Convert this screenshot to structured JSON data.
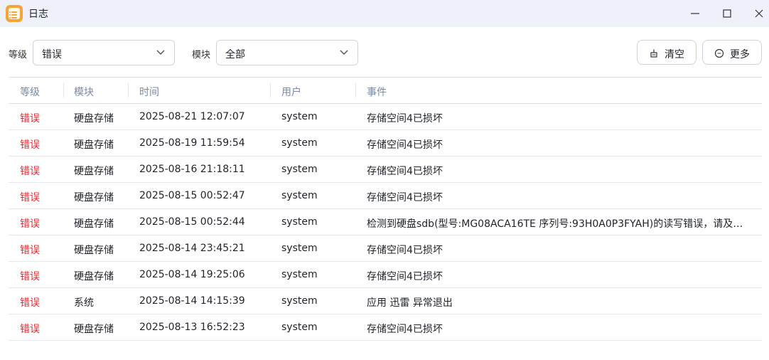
{
  "window": {
    "title": "日志"
  },
  "filters": {
    "level_label": "等级",
    "level_value": "错误",
    "module_label": "模块",
    "module_value": "全部"
  },
  "actions": {
    "clear_label": "清空",
    "more_label": "更多"
  },
  "table": {
    "columns": [
      "等级",
      "模块",
      "时间",
      "用户",
      "事件"
    ],
    "rows": [
      {
        "level": "错误",
        "module": "硬盘存储",
        "time": "2025-08-21 12:07:07",
        "user": "system",
        "event": "存储空间4已损坏"
      },
      {
        "level": "错误",
        "module": "硬盘存储",
        "time": "2025-08-19 11:59:54",
        "user": "system",
        "event": "存储空间4已损坏"
      },
      {
        "level": "错误",
        "module": "硬盘存储",
        "time": "2025-08-16 21:18:11",
        "user": "system",
        "event": "存储空间4已损坏"
      },
      {
        "level": "错误",
        "module": "硬盘存储",
        "time": "2025-08-15 00:52:47",
        "user": "system",
        "event": "存储空间4已损坏"
      },
      {
        "level": "错误",
        "module": "硬盘存储",
        "time": "2025-08-15 00:52:44",
        "user": "system",
        "event": "检测到硬盘sdb(型号:MG08ACA16TE 序列号:93H0A0P3FYAH)的读写错误，请及时..."
      },
      {
        "level": "错误",
        "module": "硬盘存储",
        "time": "2025-08-14 23:45:21",
        "user": "system",
        "event": "存储空间4已损坏"
      },
      {
        "level": "错误",
        "module": "硬盘存储",
        "time": "2025-08-14 19:25:06",
        "user": "system",
        "event": "存储空间4已损坏"
      },
      {
        "level": "错误",
        "module": "系统",
        "time": "2025-08-14 14:15:39",
        "user": "system",
        "event": "应用 迅雷 异常退出"
      },
      {
        "level": "错误",
        "module": "硬盘存储",
        "time": "2025-08-13 16:52:23",
        "user": "system",
        "event": "存储空间4已损坏"
      }
    ]
  },
  "colors": {
    "error": "#e8262e",
    "header_text": "#7a8aa6",
    "titlebar": "#eef1f9",
    "app_icon": "#f7a437"
  }
}
